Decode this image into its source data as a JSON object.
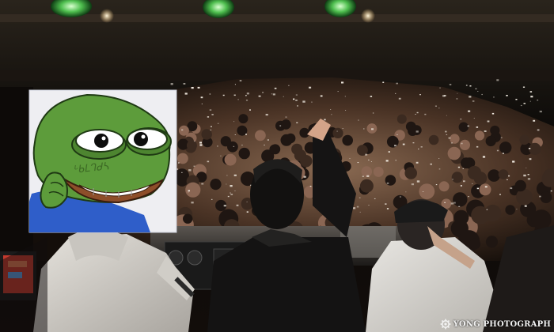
{
  "photo": {
    "subject": "dj-booth-crowd",
    "overlay": "pepe-sticker",
    "sticker_scribble": "ᒡᑲᒪᒉᑯᓴ",
    "watermark": {
      "text": "YONG PHOTOGRAPH",
      "icon": "gear-logo-icon"
    },
    "colors": {
      "stage_dark": "#0a0806",
      "crowd_warm": "#6b4a34",
      "confetti": "#f4eee4",
      "frog_green": "#5d9c3b",
      "frog_lips": "#8d4e2a",
      "frog_shirt": "#2f5ec9",
      "hoodie_grey": "#d9d6d0",
      "dj_black": "#141313"
    }
  }
}
